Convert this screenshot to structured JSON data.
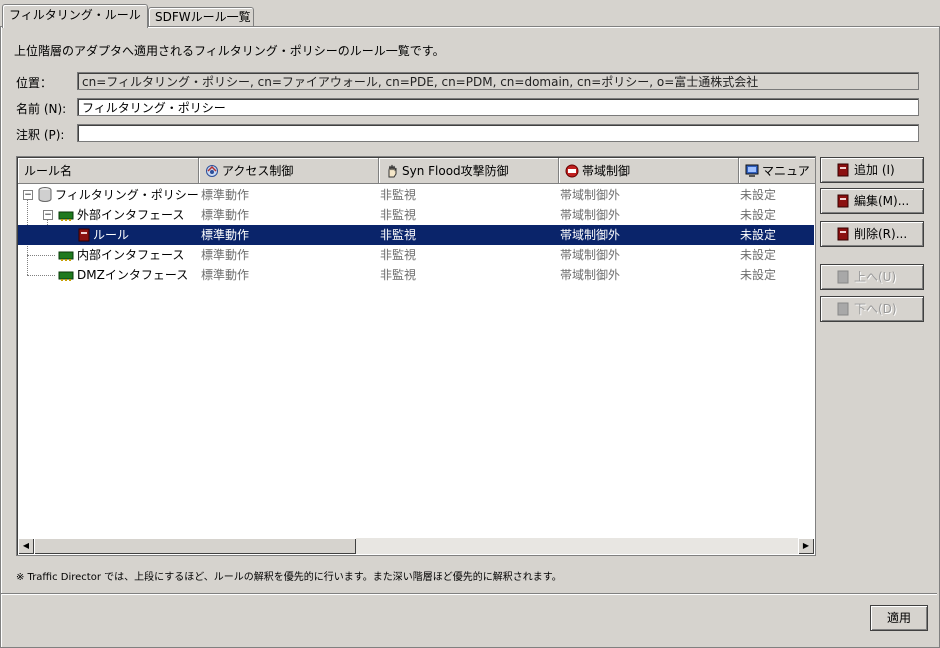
{
  "tabs": [
    {
      "label": "フィルタリング・ルール",
      "active": true
    },
    {
      "label": "SDFWルール一覧",
      "active": false
    }
  ],
  "description": "上位階層のアダプタへ適用されるフィルタリング・ポリシーのルール一覧です。",
  "fields": {
    "location_label": "位置：",
    "location_value": "cn=フィルタリング・ポリシー, cn=ファイアウォール, cn=PDE, cn=PDM, cn=domain, cn=ポリシー, o=富士通株式会社",
    "name_label": "名前 (N):",
    "name_value": "フィルタリング・ポリシー",
    "note_label": "注釈 (P):",
    "note_value": ""
  },
  "table": {
    "columns": [
      {
        "label": "ルール名",
        "icon": ""
      },
      {
        "label": "アクセス制御",
        "icon": "access-control-icon"
      },
      {
        "label": "Syn Flood攻撃防御",
        "icon": "hand-shield-icon"
      },
      {
        "label": "帯域制御",
        "icon": "bandwidth-icon"
      },
      {
        "label": "マニュア",
        "icon": "manual-monitor-icon"
      }
    ],
    "rows": [
      {
        "name": "フィルタリング・ポリシー",
        "icon": "database-icon",
        "depth": 0,
        "expander": "⊟",
        "access": "標準動作",
        "syn": "非監視",
        "bw": "帯域制御外",
        "manual": "未設定",
        "selected": false
      },
      {
        "name": "外部インタフェース",
        "icon": "network-card-icon",
        "depth": 1,
        "expander": "⊟",
        "access": "標準動作",
        "syn": "非監視",
        "bw": "帯域制御外",
        "manual": "未設定",
        "selected": false
      },
      {
        "name": "ルール",
        "icon": "rule-book-icon",
        "depth": 2,
        "expander": "",
        "access": "標準動作",
        "syn": "非監視",
        "bw": "帯域制御外",
        "manual": "未設定",
        "selected": true
      },
      {
        "name": "内部インタフェース",
        "icon": "network-card-icon",
        "depth": 1,
        "expander": "",
        "access": "標準動作",
        "syn": "非監視",
        "bw": "帯域制御外",
        "manual": "未設定",
        "selected": false
      },
      {
        "name": "DMZインタフェース",
        "icon": "network-card-icon",
        "depth": 1,
        "expander": "",
        "access": "標準動作",
        "syn": "非監視",
        "bw": "帯域制御外",
        "manual": "未設定",
        "selected": false
      }
    ]
  },
  "buttons": {
    "add": "追加 (I)",
    "edit": "編集(M)...",
    "delete": "削除(R)...",
    "up": "上へ(U)",
    "down": "下へ(D)",
    "apply": "適用"
  },
  "footnote": "※ Traffic Director では、上段にするほど、ルールの解釈を優先的に行います。また深い階層ほど優先的に解釈されます。",
  "colors": {
    "selection": "#0a246a",
    "background": "#d6d3ce",
    "rule_icon": "#8b1010",
    "nic_icon": "#1f7a1f"
  }
}
